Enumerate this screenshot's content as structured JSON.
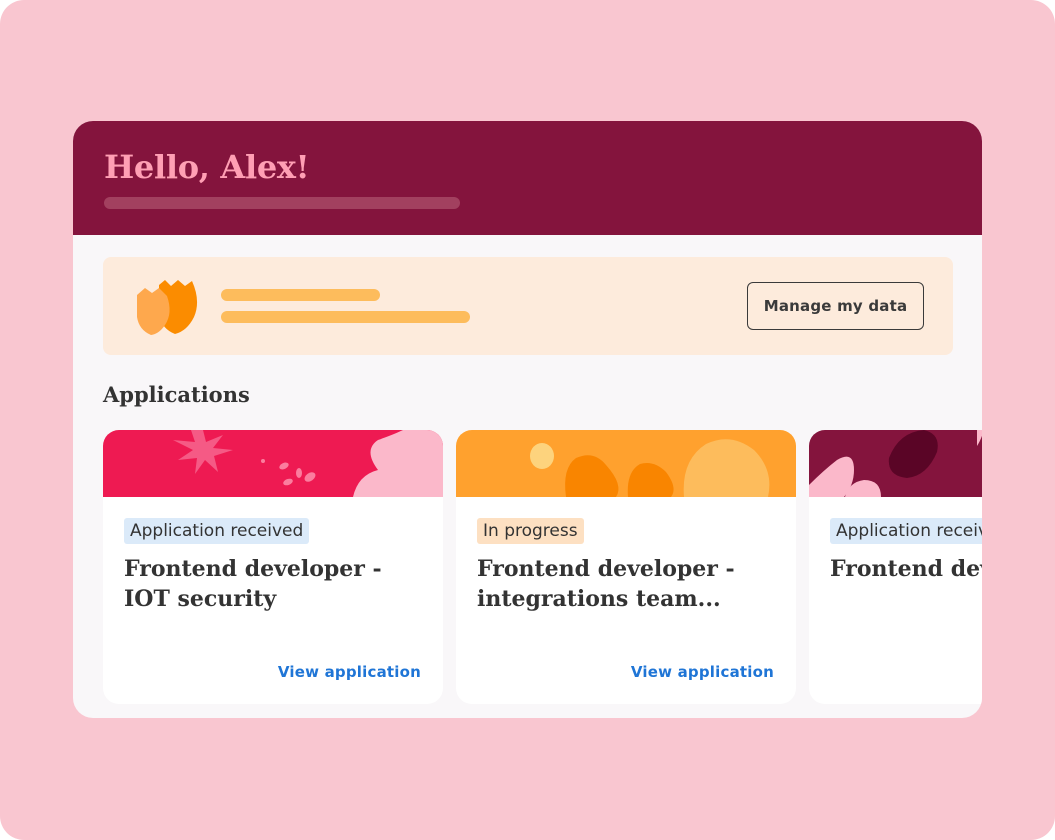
{
  "header": {
    "greeting": "Hello, Alex!",
    "colors": {
      "background": "#84143d",
      "greeting_text": "#ff9fb4"
    }
  },
  "privacy_banner": {
    "icon": "shield-icon",
    "button_label": "Manage my data",
    "colors": {
      "background": "#fdebdc",
      "accent": "#fb8c00"
    }
  },
  "applications": {
    "heading": "Applications",
    "cards": [
      {
        "status": "Application received",
        "title": "Frontend developer - IOT security",
        "link_label": "View application",
        "banner_color": "#ee1a52"
      },
      {
        "status": "In progress",
        "title": "Frontend developer - integrations team...",
        "link_label": "View application",
        "banner_color": "#ffa12e"
      },
      {
        "status": "Application received",
        "title": "Frontend developer",
        "banner_color": "#84143d"
      }
    ]
  },
  "colors": {
    "page_background": "#f9c6d0",
    "link": "#1f75d6",
    "badge_received": "#dbeaf9",
    "badge_in_progress": "#fde0c2"
  }
}
